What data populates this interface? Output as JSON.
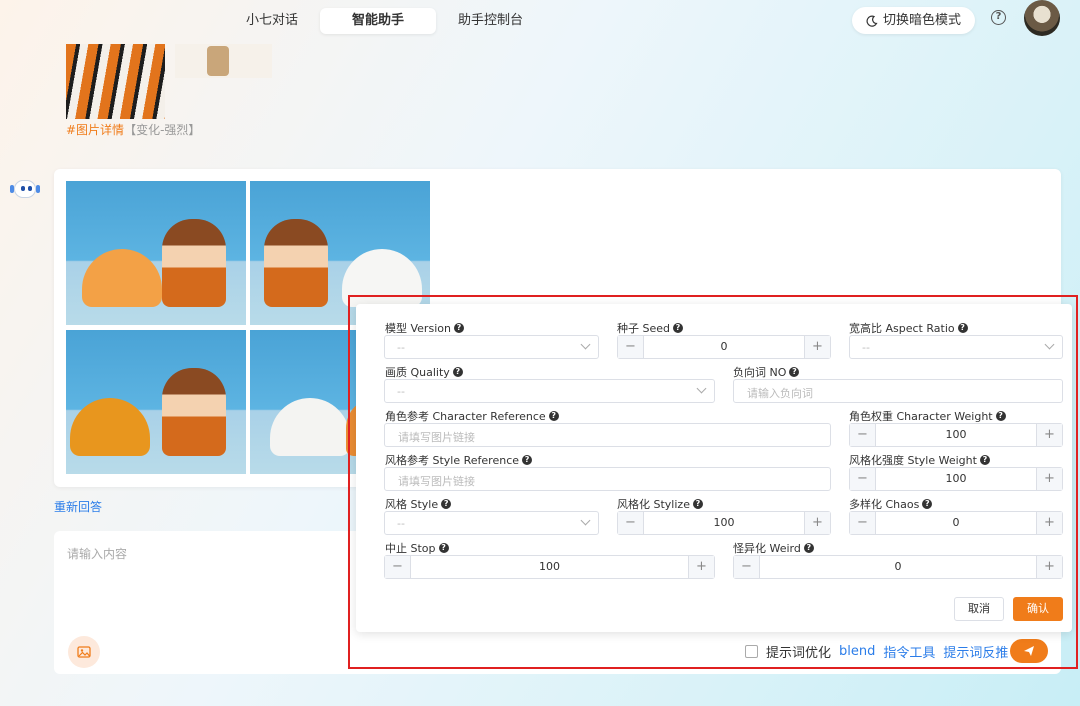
{
  "nav": {
    "tabs": [
      {
        "label": "小七对话"
      },
      {
        "label": "智能助手"
      },
      {
        "label": "助手控制台"
      }
    ],
    "theme_toggle": "切换暗色模式",
    "help": "?"
  },
  "history": {
    "hash_tag": "#图片详情",
    "hash_meta": "【变化-强烈】"
  },
  "response": {
    "regenerate": "重新回答"
  },
  "settings": {
    "version_label": "模型 Version",
    "version_value": "--",
    "seed_label": "种子 Seed",
    "seed_value": "0",
    "aspect_label": "宽高比 Aspect Ratio",
    "aspect_value": "--",
    "quality_label": "画质 Quality",
    "quality_value": "--",
    "negative_label": "负向词 NO",
    "negative_placeholder": "请输入负向词",
    "char_ref_label": "角色参考 Character Reference",
    "char_ref_placeholder": "请填写图片链接",
    "char_weight_label": "角色权重 Character Weight",
    "char_weight_value": "100",
    "style_ref_label": "风格参考 Style Reference",
    "style_ref_placeholder": "请填写图片链接",
    "style_weight_label": "风格化强度 Style Weight",
    "style_weight_value": "100",
    "style_label": "风格 Style",
    "style_value": "--",
    "stylize_label": "风格化 Stylize",
    "stylize_value": "100",
    "chaos_label": "多样化 Chaos",
    "chaos_value": "0",
    "stop_label": "中止 Stop",
    "stop_value": "100",
    "weird_label": "怪异化 Weird",
    "weird_value": "0",
    "minus": "−",
    "plus": "+",
    "cancel": "取消",
    "confirm": "确认"
  },
  "composer": {
    "placeholder": "请输入内容",
    "optimize": "提示词优化",
    "blend": "blend",
    "command_tool": "指令工具",
    "reverse_prompt": "提示词反推"
  },
  "colors": {
    "accent": "#f07c1a",
    "link": "#2b7de9",
    "highlight": "#e02020"
  }
}
